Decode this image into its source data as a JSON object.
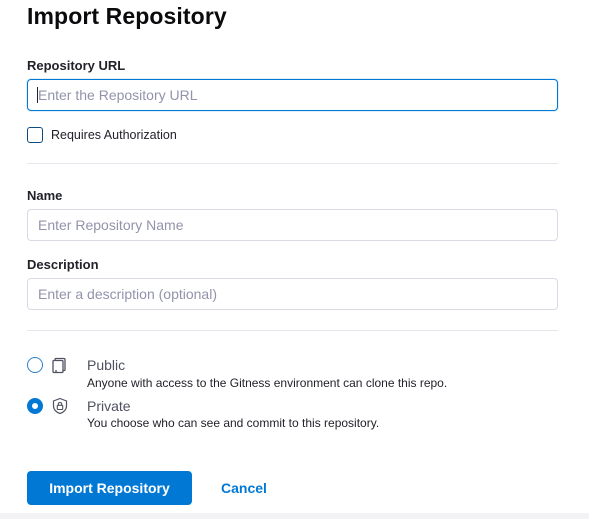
{
  "page": {
    "title": "Import Repository"
  },
  "form": {
    "repo_url": {
      "label": "Repository URL",
      "placeholder": "Enter the Repository URL",
      "value": ""
    },
    "requires_auth": {
      "label": "Requires Authorization",
      "checked": false
    },
    "name": {
      "label": "Name",
      "placeholder": "Enter Repository Name",
      "value": ""
    },
    "description": {
      "label": "Description",
      "placeholder": "Enter a description (optional)",
      "value": ""
    },
    "visibility": {
      "selected": "private",
      "options": [
        {
          "id": "public",
          "title": "Public",
          "description": "Anyone with access to the Gitness environment can clone this repo.",
          "icon": "repo-public-icon"
        },
        {
          "id": "private",
          "title": "Private",
          "description": "You choose who can see and commit to this repository.",
          "icon": "lock-shield-icon"
        }
      ]
    }
  },
  "actions": {
    "submit_label": "Import Repository",
    "cancel_label": "Cancel"
  },
  "colors": {
    "accent": "#0278d5",
    "text": "#22222a",
    "placeholder": "#9293ab",
    "border": "#d9dae5"
  }
}
